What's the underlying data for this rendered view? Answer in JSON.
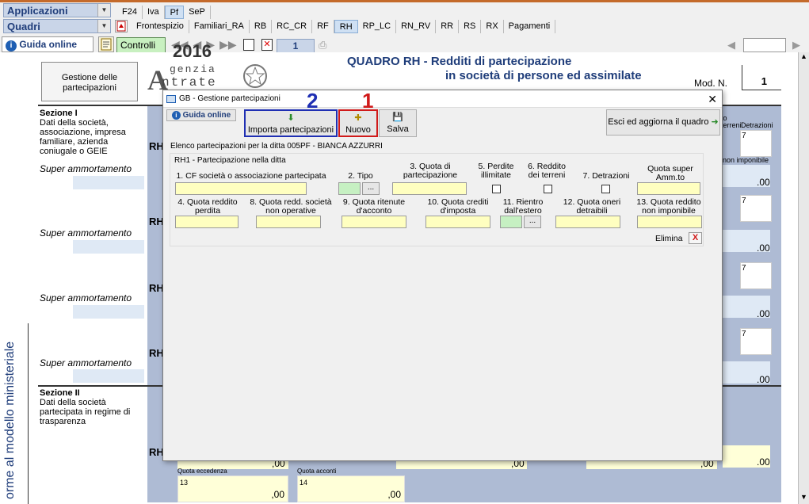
{
  "menu": {
    "applicazioni": "Applicazioni",
    "quadri": "Quadri",
    "top_tabs": [
      "F24",
      "Iva",
      "Pf",
      "SeP"
    ],
    "quadri_tabs": [
      "Frontespizio",
      "Familiari_RA",
      "RB",
      "RC_CR",
      "RF",
      "RH",
      "RP_LC",
      "RN_RV",
      "RR",
      "RS",
      "RX",
      "Pagamenti"
    ],
    "selected_top": "Pf",
    "selected_quadro": "RH"
  },
  "toolbar": {
    "guida": "Guida online",
    "controlli": "Controlli",
    "page_number": "1"
  },
  "form": {
    "gestione_btn": "Gestione delle partecipazioni",
    "logo_line1": "genzia",
    "logo_line2": "ntrate",
    "logo_letter": "A",
    "year_partial": "2016",
    "title1": "QUADRO RH - Redditi di partecipazione",
    "title2": "in società di persone ed assimilate",
    "mod_label": "Mod. N.",
    "mod_value": "1",
    "sezione1_title": "Sezione I",
    "sezione1_text": "Dati della società, associazione, impresa familiare, azienda coniugale o GEIE",
    "super_amm": "Super ammortamento",
    "rh": "RH",
    "seven": "7",
    "zero": ",00",
    "zero_dot": ".00",
    "col_terreni": "terreni",
    "col_detrazioni": "Detrazioni",
    "col_to": "to",
    "non_imponibile": "non imponibile",
    "sezione2_title": "Sezione II",
    "sezione2_text": "Dati della società partecipata in regime di trasparenza",
    "quota_eccedenza": "Quota eccedenza",
    "quota_acconti": "Quota acconti",
    "n13": "13",
    "n14": "14",
    "vertical_text": "orme al modello ministeriale"
  },
  "dialog": {
    "title": "GB - Gestione partecipazioni",
    "guida": "Guida online",
    "importa": "Importa partecipazioni",
    "nuovo": "Nuovo",
    "salva": "Salva",
    "esci": "Esci ed aggiorna il quadro",
    "annot_2": "2",
    "annot_1": "1",
    "elenco": "Elenco partecipazioni per la ditta 005PF - BIANCA AZZURRI",
    "group_title": "RH1 - Partecipazione nella ditta",
    "labels": {
      "cf": "1. CF società o associazione partecipata",
      "tipo": "2. Tipo",
      "quota_part": "3. Quota di partecipazione",
      "perdite": "5. Perdite illimitate",
      "reddito_terreni": "6. Reddito dei terreni",
      "detrazioni": "7. Detrazioni",
      "quota_super": "Quota super Amm.to",
      "quota_perdita": "4. Quota reddito perdita",
      "quota_redd_non_op": "8. Quota redd. società non operative",
      "quota_ritenute": "9. Quota ritenute d'acconto",
      "quota_crediti": "10. Quota crediti d'imposta",
      "rientro": "11. Rientro dall'estero",
      "quota_oneri": "12. Quota oneri detraibili",
      "quota_non_imp": "13. Quota reddito non imponibile"
    },
    "elimina": "Elimina",
    "elimina_x": "X",
    "dots": "..."
  }
}
